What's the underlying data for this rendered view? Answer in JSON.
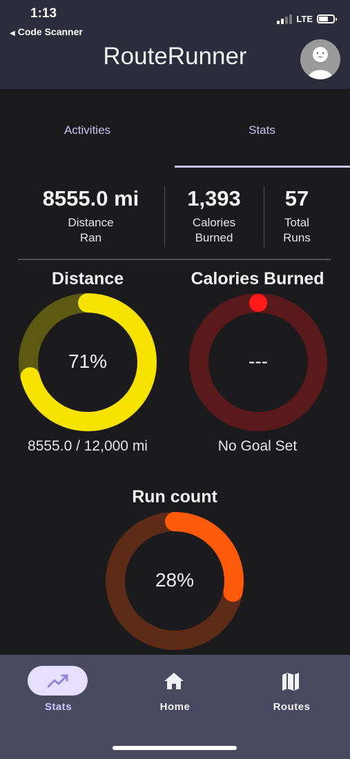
{
  "status_bar": {
    "time": "1:13",
    "back_label": "Code Scanner",
    "network": "LTE"
  },
  "header": {
    "title": "RouteRunner"
  },
  "tabs": [
    {
      "label": "Activities",
      "selected": false
    },
    {
      "label": "Stats",
      "selected": true
    }
  ],
  "summary": {
    "distance": {
      "value": "8555.0 mi",
      "label_line1": "Distance",
      "label_line2": "Ran"
    },
    "calories": {
      "value": "1,393",
      "label_line1": "Calories",
      "label_line2": "Burned"
    },
    "runs": {
      "value": "57",
      "label_line1": "Total",
      "label_line2": "Runs"
    }
  },
  "rings": {
    "distance": {
      "title": "Distance",
      "center": "71%",
      "caption": "8555.0 / 12,000 mi",
      "progress": 0.71,
      "color": "#f7e200",
      "track_color": "#5c5a12"
    },
    "calories": {
      "title": "Calories Burned",
      "center": "---",
      "caption": "No Goal Set",
      "progress": 0.0,
      "color": "#ff1a1a",
      "track_color": "#5a1a1c"
    },
    "runs": {
      "title": "Run count",
      "center": "28%",
      "progress": 0.28,
      "color": "#ff5a0a",
      "track_color": "#5e2b18"
    }
  },
  "bottom_nav": [
    {
      "label": "Stats",
      "icon": "trending-up-icon",
      "active": true
    },
    {
      "label": "Home",
      "icon": "home-icon",
      "active": false
    },
    {
      "label": "Routes",
      "icon": "map-icon",
      "active": false
    }
  ]
}
